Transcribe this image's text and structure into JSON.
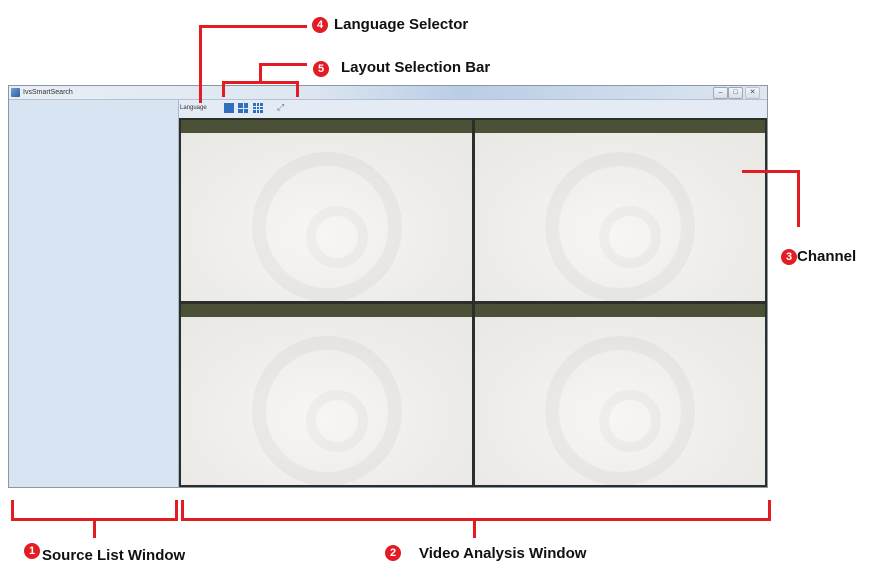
{
  "window": {
    "title": "IvsSmartSearch",
    "buttons": {
      "minimize": "–",
      "maximize": "□",
      "close": "✕"
    }
  },
  "toolbar": {
    "language_label": "Language",
    "layout_options": [
      "1",
      "4",
      "9"
    ],
    "selected_layout": "4",
    "fullscreen_icon": "fullscreen-icon"
  },
  "video_area": {
    "channels": [
      "channel-1",
      "channel-2",
      "channel-3",
      "channel-4"
    ]
  },
  "callouts": [
    {
      "number": "1",
      "label": "Source List Window"
    },
    {
      "number": "2",
      "label": "Video Analysis Window"
    },
    {
      "number": "3",
      "label": "Channel"
    },
    {
      "number": "4",
      "label": "Language Selector"
    },
    {
      "number": "5",
      "label": "Layout Selection Bar"
    }
  ],
  "colors": {
    "annotation_red": "#e31b23",
    "layout_button_blue": "#2f6fc0",
    "source_list_bg": "#d8e4f1"
  }
}
